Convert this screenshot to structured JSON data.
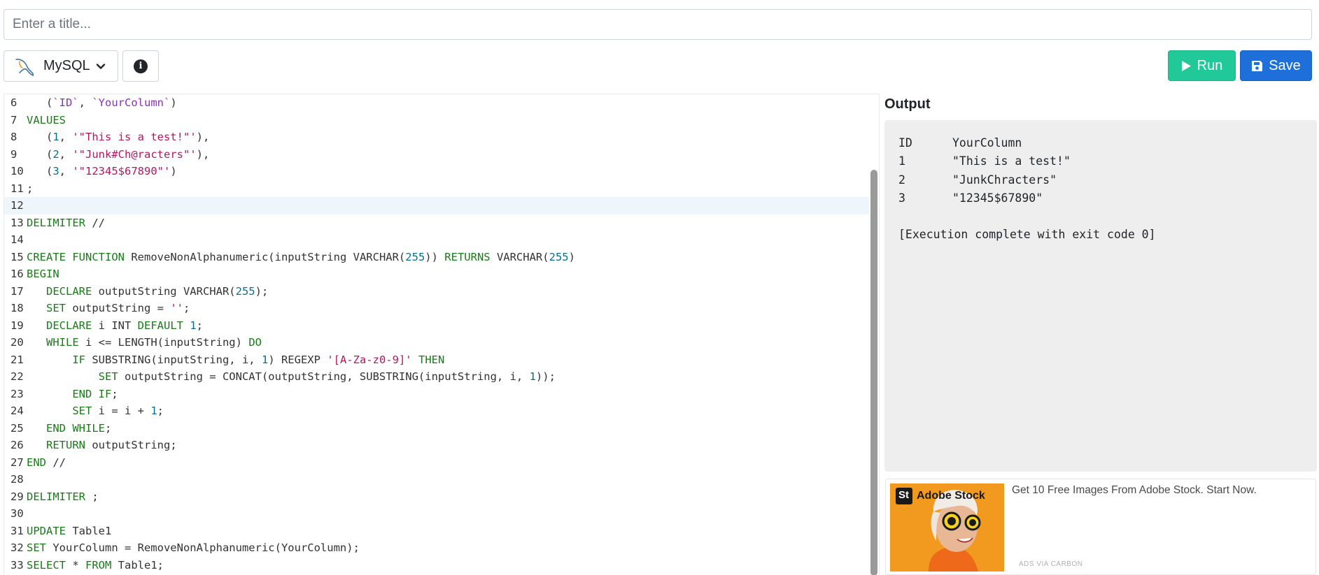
{
  "title_input": {
    "placeholder": "Enter a title..."
  },
  "toolbar": {
    "language": "MySQL",
    "run_label": "Run",
    "save_label": "Save",
    "colors": {
      "run": "#20c997",
      "save": "#1e6fd9"
    }
  },
  "editor": {
    "active_line": 12,
    "lines": [
      {
        "n": "6",
        "tokens": [
          [
            "code",
            "   ("
          ],
          [
            "bq",
            "`ID`"
          ],
          [
            "code",
            ", "
          ],
          [
            "bq",
            "`YourColumn`"
          ],
          [
            "code",
            ")"
          ]
        ]
      },
      {
        "n": "7",
        "tokens": [
          [
            "kw",
            "VALUES"
          ]
        ]
      },
      {
        "n": "8",
        "tokens": [
          [
            "code",
            "   ("
          ],
          [
            "num",
            "1"
          ],
          [
            "code",
            ", "
          ],
          [
            "str",
            "'\"This is a test!\"'"
          ],
          [
            "code",
            "),"
          ]
        ]
      },
      {
        "n": "9",
        "tokens": [
          [
            "code",
            "   ("
          ],
          [
            "num",
            "2"
          ],
          [
            "code",
            ", "
          ],
          [
            "str",
            "'\"Junk#Ch@racters\"'"
          ],
          [
            "code",
            "),"
          ]
        ]
      },
      {
        "n": "10",
        "tokens": [
          [
            "code",
            "   ("
          ],
          [
            "num",
            "3"
          ],
          [
            "code",
            ", "
          ],
          [
            "str",
            "'\"12345$67890\"'"
          ],
          [
            "code",
            ")"
          ]
        ]
      },
      {
        "n": "11",
        "tokens": [
          [
            "code",
            ";"
          ]
        ]
      },
      {
        "n": "12",
        "tokens": []
      },
      {
        "n": "13",
        "tokens": [
          [
            "kw",
            "DELIMITER"
          ],
          [
            "code",
            " //"
          ]
        ]
      },
      {
        "n": "14",
        "tokens": []
      },
      {
        "n": "15",
        "tokens": [
          [
            "kw",
            "CREATE"
          ],
          [
            "code",
            " "
          ],
          [
            "kw",
            "FUNCTION"
          ],
          [
            "code",
            " RemoveNonAlphanumeric(inputString VARCHAR("
          ],
          [
            "num",
            "255"
          ],
          [
            "code",
            ")) "
          ],
          [
            "kw",
            "RETURNS"
          ],
          [
            "code",
            " VARCHAR("
          ],
          [
            "num",
            "255"
          ],
          [
            "code",
            ")"
          ]
        ]
      },
      {
        "n": "16",
        "tokens": [
          [
            "kw",
            "BEGIN"
          ]
        ]
      },
      {
        "n": "17",
        "tokens": [
          [
            "code",
            "   "
          ],
          [
            "kw",
            "DECLARE"
          ],
          [
            "code",
            " outputString VARCHAR("
          ],
          [
            "num",
            "255"
          ],
          [
            "code",
            ");"
          ]
        ]
      },
      {
        "n": "18",
        "tokens": [
          [
            "code",
            "   "
          ],
          [
            "kw",
            "SET"
          ],
          [
            "code",
            " outputString = "
          ],
          [
            "str",
            "''"
          ],
          [
            "code",
            ";"
          ]
        ]
      },
      {
        "n": "19",
        "tokens": [
          [
            "code",
            "   "
          ],
          [
            "kw",
            "DECLARE"
          ],
          [
            "code",
            " i INT "
          ],
          [
            "kw",
            "DEFAULT"
          ],
          [
            "code",
            " "
          ],
          [
            "num",
            "1"
          ],
          [
            "code",
            ";"
          ]
        ]
      },
      {
        "n": "20",
        "tokens": [
          [
            "code",
            "   "
          ],
          [
            "kw",
            "WHILE"
          ],
          [
            "code",
            " i <= LENGTH(inputString) "
          ],
          [
            "kw",
            "DO"
          ]
        ]
      },
      {
        "n": "21",
        "tokens": [
          [
            "code",
            "       "
          ],
          [
            "kw",
            "IF"
          ],
          [
            "code",
            " SUBSTRING(inputString, i, "
          ],
          [
            "num",
            "1"
          ],
          [
            "code",
            ") REGEXP "
          ],
          [
            "str",
            "'[A-Za-z0-9]'"
          ],
          [
            "code",
            " "
          ],
          [
            "kw",
            "THEN"
          ]
        ]
      },
      {
        "n": "22",
        "tokens": [
          [
            "code",
            "           "
          ],
          [
            "kw",
            "SET"
          ],
          [
            "code",
            " outputString = CONCAT(outputString, SUBSTRING(inputString, i, "
          ],
          [
            "num",
            "1"
          ],
          [
            "code",
            "));"
          ]
        ]
      },
      {
        "n": "23",
        "tokens": [
          [
            "code",
            "       "
          ],
          [
            "kw",
            "END IF"
          ],
          [
            "code",
            ";"
          ]
        ]
      },
      {
        "n": "24",
        "tokens": [
          [
            "code",
            "       "
          ],
          [
            "kw",
            "SET"
          ],
          [
            "code",
            " i = i + "
          ],
          [
            "num",
            "1"
          ],
          [
            "code",
            ";"
          ]
        ]
      },
      {
        "n": "25",
        "tokens": [
          [
            "code",
            "   "
          ],
          [
            "kw",
            "END WHILE"
          ],
          [
            "code",
            ";"
          ]
        ]
      },
      {
        "n": "26",
        "tokens": [
          [
            "code",
            "   "
          ],
          [
            "kw",
            "RETURN"
          ],
          [
            "code",
            " outputString;"
          ]
        ]
      },
      {
        "n": "27",
        "tokens": [
          [
            "kw",
            "END"
          ],
          [
            "code",
            " //"
          ]
        ]
      },
      {
        "n": "28",
        "tokens": []
      },
      {
        "n": "29",
        "tokens": [
          [
            "kw",
            "DELIMITER"
          ],
          [
            "code",
            " ;"
          ]
        ]
      },
      {
        "n": "30",
        "tokens": []
      },
      {
        "n": "31",
        "tokens": [
          [
            "kw",
            "UPDATE"
          ],
          [
            "code",
            " Table1"
          ]
        ]
      },
      {
        "n": "32",
        "tokens": [
          [
            "kw",
            "SET"
          ],
          [
            "code",
            " YourColumn = RemoveNonAlphanumeric(YourColumn);"
          ]
        ]
      },
      {
        "n": "33",
        "tokens": [
          [
            "kw",
            "SELECT"
          ],
          [
            "code",
            " * "
          ],
          [
            "kw",
            "FROM"
          ],
          [
            "code",
            " Table1;"
          ]
        ]
      }
    ]
  },
  "output": {
    "title": "Output",
    "header": [
      "ID",
      "YourColumn"
    ],
    "rows": [
      [
        "1",
        "\"This is a test!\""
      ],
      [
        "2",
        "\"JunkChracters\""
      ],
      [
        "3",
        "\"12345$67890\""
      ]
    ],
    "status": "[Execution complete with exit code 0]"
  },
  "ad": {
    "brand_badge": "St",
    "brand_name": "Adobe Stock",
    "text": "Get 10 Free Images From Adobe Stock. Start Now.",
    "via": "ADS VIA CARBON"
  }
}
